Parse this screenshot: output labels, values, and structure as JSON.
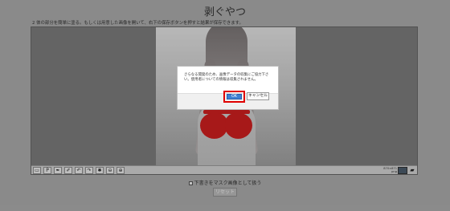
{
  "page": {
    "title": "剥ぐやつ",
    "instructions": "2 体の部分を簡単に塗る。もしくは用意した画像を開いて、右下の保存ボタンを押すと結果が保存できます。"
  },
  "toolbar": {
    "tools": [
      {
        "name": "rectangle-tool",
        "glyph": "▭"
      },
      {
        "name": "pen-tool",
        "glyph": "P"
      },
      {
        "name": "brush-tool",
        "glyph": "✒"
      },
      {
        "name": "bucket-tool",
        "glyph": "✐"
      },
      {
        "name": "undo-tool",
        "glyph": "↶"
      },
      {
        "name": "redo-tool",
        "glyph": "↷"
      },
      {
        "name": "settings-tool",
        "glyph": "✱"
      },
      {
        "name": "zoom-out-tool",
        "glyph": "⊖"
      },
      {
        "name": "zoom-in-tool",
        "glyph": "⊕"
      }
    ],
    "size_label_line1": "870×871",
    "size_label_line2": "png",
    "brush_color": "#4a5a6a",
    "folder_glyph": "▰"
  },
  "mask_option": {
    "label": "下書きをマスク画像として扱う",
    "checked": true
  },
  "reset_label": "リセット",
  "dialog": {
    "message": "さらなる開発のため、画像データの収集にご協力下さい。使用者についての情報は収集されません。",
    "ok_label": "OK",
    "cancel_label": "キャンセル"
  },
  "colors": {
    "background": "#a9a9a9",
    "mask_paint": "#cc1f1f",
    "ok_button": "#3c7fd3",
    "highlight": "#e00000"
  }
}
